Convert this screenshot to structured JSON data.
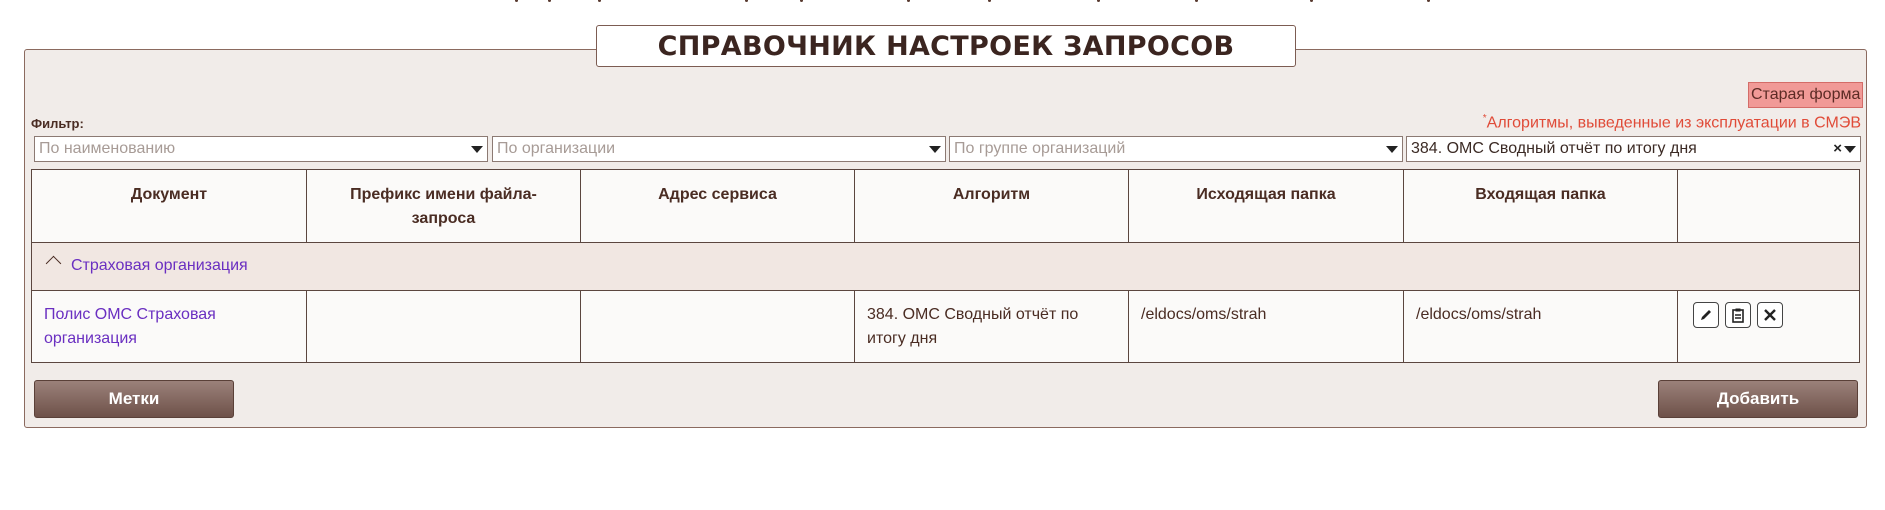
{
  "title": "СПРАВОЧНИК НАСТРОЕК ЗАПРОСОВ",
  "old_form_label": "Старая форма",
  "filter_label": "Фильтр:",
  "note": {
    "mark": "*",
    "text": "Алгоритмы, выведенные из эксплуатации в СМЭВ"
  },
  "filters": {
    "name_placeholder": "По наименованию",
    "org_placeholder": "По организации",
    "group_placeholder": "По группе организаций",
    "algorithm_value": "384. ОМС Сводный отчёт по итогу дня",
    "clear_symbol": "×"
  },
  "table": {
    "headers": [
      "Документ",
      "Префикс имени файла-запроса",
      "Адрес сервиса",
      "Алгоритм",
      "Исходящая папка",
      "Входящая папка",
      ""
    ],
    "group": "Страховая организация",
    "row": {
      "document": "Полис ОМС Страховая организация",
      "prefix": "",
      "service": "",
      "algorithm": "384. ОМС Сводный отчёт по итогу дня",
      "out_folder": "/eldocs/oms/strah",
      "in_folder": "/eldocs/oms/strah"
    },
    "actions": [
      "edit-icon",
      "clipboard-icon",
      "delete-icon"
    ]
  },
  "buttons": {
    "tags": "Метки",
    "add": "Добавить"
  }
}
